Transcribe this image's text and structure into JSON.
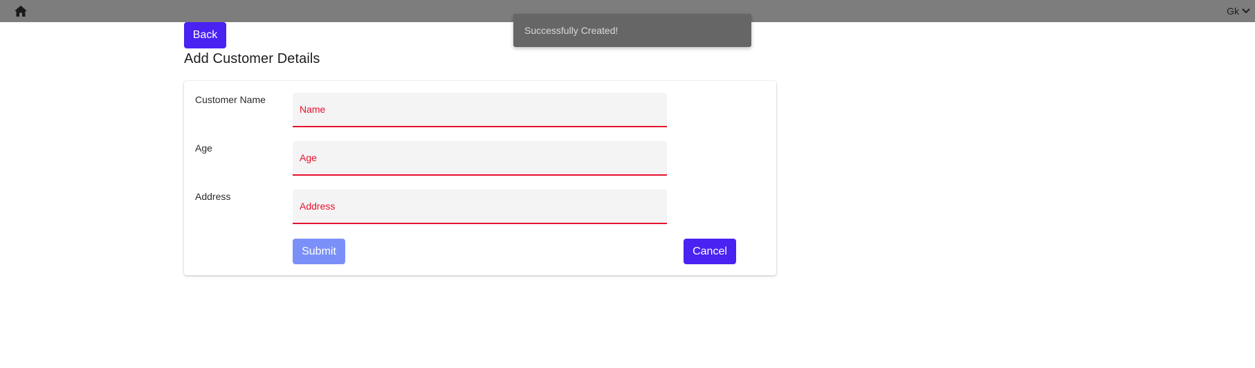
{
  "topbar": {
    "home_icon": "home-icon",
    "user_name": "Gk",
    "user_menu_icon": "chevron-down-icon"
  },
  "toast": {
    "message": "Successfully Created!"
  },
  "header": {
    "back_label": "Back",
    "title": "Add Customer Details"
  },
  "form": {
    "fields": [
      {
        "label": "Customer Name",
        "placeholder": "Name",
        "value": ""
      },
      {
        "label": "Age",
        "placeholder": "Age",
        "value": ""
      },
      {
        "label": "Address",
        "placeholder": "Address",
        "value": ""
      }
    ],
    "submit_label": "Submit",
    "cancel_label": "Cancel"
  },
  "colors": {
    "primary": "#4a22f2",
    "primary_disabled": "#7a90f8",
    "error": "#e8102e",
    "topbar": "#7d7d7d",
    "toast": "#666666"
  }
}
